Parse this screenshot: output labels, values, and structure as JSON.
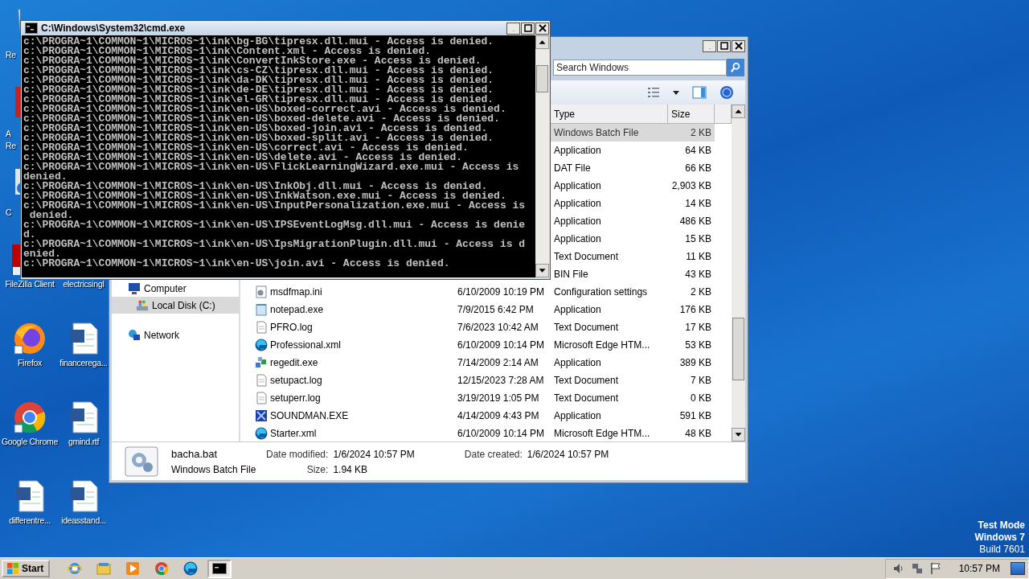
{
  "desktop": {
    "columns": [
      [
        {
          "label": "Re",
          "kind": "bin",
          "covered": true
        },
        {
          "label": "A Re",
          "kind": "acrobat",
          "covered": true
        },
        {
          "label": "C",
          "kind": "app",
          "covered": true
        },
        {
          "label": "FileZilla Client",
          "kind": "filezilla",
          "covered": false
        },
        {
          "label": "Firefox",
          "kind": "firefox",
          "covered": false
        },
        {
          "label": "Google Chrome",
          "kind": "chrome",
          "covered": false
        },
        {
          "label": "differentre...",
          "kind": "word",
          "covered": false
        }
      ],
      [
        {
          "label": "electricsingl",
          "kind": "word",
          "covered": false
        },
        {
          "label": "financerega...",
          "kind": "word",
          "covered": false
        },
        {
          "label": "gmind.rtf",
          "kind": "word",
          "covered": false
        },
        {
          "label": "ideasstand...",
          "kind": "word",
          "covered": false
        }
      ]
    ]
  },
  "explorer": {
    "search": {
      "placeholder": "Search Windows"
    },
    "columns": [
      "Type",
      "Size"
    ],
    "nav": [
      {
        "label": "Computer",
        "kind": "computer",
        "selected": false,
        "children": [
          {
            "label": "Local Disk (C:)",
            "kind": "drive",
            "selected": true
          }
        ]
      },
      {
        "label": "Network",
        "kind": "network",
        "selected": false
      }
    ],
    "rows": [
      {
        "type": "Windows Batch File",
        "size": "2 KB",
        "selected": true
      },
      {
        "type": "Application",
        "size": "64 KB",
        "selected": false
      },
      {
        "type": "DAT File",
        "size": "66 KB",
        "selected": false
      },
      {
        "type": "Application",
        "size": "2,903 KB",
        "selected": false
      },
      {
        "type": "Application",
        "size": "14 KB",
        "selected": false
      },
      {
        "type": "Application",
        "size": "486 KB",
        "selected": false
      },
      {
        "type": "Application",
        "size": "15 KB",
        "selected": false
      },
      {
        "type": "Text Document",
        "size": "11 KB",
        "selected": false
      },
      {
        "type": "BIN File",
        "size": "43 KB",
        "selected": false
      },
      {
        "name": "msdfmap.ini",
        "kind": "ini",
        "date": "6/10/2009 10:19 PM",
        "type": "Configuration settings",
        "size": "2 KB",
        "selected": false
      },
      {
        "name": "notepad.exe",
        "kind": "notepad",
        "date": "7/9/2015 6:42 PM",
        "type": "Application",
        "size": "176 KB",
        "selected": false
      },
      {
        "name": "PFRO.log",
        "kind": "text",
        "date": "7/6/2023 10:42 AM",
        "type": "Text Document",
        "size": "17 KB",
        "selected": false
      },
      {
        "name": "Professional.xml",
        "kind": "edge",
        "date": "6/10/2009 10:14 PM",
        "type": "Microsoft Edge HTM...",
        "size": "53 KB",
        "selected": false
      },
      {
        "name": "regedit.exe",
        "kind": "regedit",
        "date": "7/14/2009 2:14 AM",
        "type": "Application",
        "size": "389 KB",
        "selected": false
      },
      {
        "name": "setupact.log",
        "kind": "text",
        "date": "12/15/2023 7:28 AM",
        "type": "Text Document",
        "size": "7 KB",
        "selected": false
      },
      {
        "name": "setuperr.log",
        "kind": "text",
        "date": "3/19/2019 1:05 PM",
        "type": "Text Document",
        "size": "0 KB",
        "selected": false
      },
      {
        "name": "SOUNDMAN.EXE",
        "kind": "sound",
        "date": "4/14/2009 4:43 PM",
        "type": "Application",
        "size": "591 KB",
        "selected": false
      },
      {
        "name": "Starter.xml",
        "kind": "edge",
        "date": "6/10/2009 10:14 PM",
        "type": "Microsoft Edge HTM...",
        "size": "48 KB",
        "selected": false
      }
    ],
    "details": {
      "name": "bacha.bat",
      "type": "Windows Batch File",
      "modified_label": "Date modified:",
      "modified": "1/6/2024 10:57 PM",
      "created_label": "Date created:",
      "created": "1/6/2024 10:57 PM",
      "size_label": "Size:",
      "size": "1.94 KB"
    }
  },
  "cmd": {
    "title": "C:\\Windows\\System32\\cmd.exe",
    "lines": [
      "c:\\PROGRA~1\\COMMON~1\\MICROS~1\\ink\\bg-BG\\tipresx.dll.mui - Access is denied.",
      "c:\\PROGRA~1\\COMMON~1\\MICROS~1\\ink\\Content.xml - Access is denied.",
      "c:\\PROGRA~1\\COMMON~1\\MICROS~1\\ink\\ConvertInkStore.exe - Access is denied.",
      "c:\\PROGRA~1\\COMMON~1\\MICROS~1\\ink\\cs-CZ\\tipresx.dll.mui - Access is denied.",
      "c:\\PROGRA~1\\COMMON~1\\MICROS~1\\ink\\da-DK\\tipresx.dll.mui - Access is denied.",
      "c:\\PROGRA~1\\COMMON~1\\MICROS~1\\ink\\de-DE\\tipresx.dll.mui - Access is denied.",
      "c:\\PROGRA~1\\COMMON~1\\MICROS~1\\ink\\el-GR\\tipresx.dll.mui - Access is denied.",
      "c:\\PROGRA~1\\COMMON~1\\MICROS~1\\ink\\en-US\\boxed-correct.avi - Access is denied.",
      "c:\\PROGRA~1\\COMMON~1\\MICROS~1\\ink\\en-US\\boxed-delete.avi - Access is denied.",
      "c:\\PROGRA~1\\COMMON~1\\MICROS~1\\ink\\en-US\\boxed-join.avi - Access is denied.",
      "c:\\PROGRA~1\\COMMON~1\\MICROS~1\\ink\\en-US\\boxed-split.avi - Access is denied.",
      "c:\\PROGRA~1\\COMMON~1\\MICROS~1\\ink\\en-US\\correct.avi - Access is denied.",
      "c:\\PROGRA~1\\COMMON~1\\MICROS~1\\ink\\en-US\\delete.avi - Access is denied.",
      "c:\\PROGRA~1\\COMMON~1\\MICROS~1\\ink\\en-US\\FlickLearningWizard.exe.mui - Access is",
      "denied.",
      "c:\\PROGRA~1\\COMMON~1\\MICROS~1\\ink\\en-US\\InkObj.dll.mui - Access is denied.",
      "c:\\PROGRA~1\\COMMON~1\\MICROS~1\\ink\\en-US\\InkWatson.exe.mui - Access is denied.",
      "c:\\PROGRA~1\\COMMON~1\\MICROS~1\\ink\\en-US\\InputPersonalization.exe.mui - Access is",
      " denied.",
      "c:\\PROGRA~1\\COMMON~1\\MICROS~1\\ink\\en-US\\IPSEventLogMsg.dll.mui - Access is denie",
      "d.",
      "c:\\PROGRA~1\\COMMON~1\\MICROS~1\\ink\\en-US\\IpsMigrationPlugin.dll.mui - Access is d",
      "enied.",
      "c:\\PROGRA~1\\COMMON~1\\MICROS~1\\ink\\en-US\\join.avi - Access is denied."
    ]
  },
  "system_notice": [
    {
      "text": "Test Mode",
      "bold": true
    },
    {
      "text": "Windows 7",
      "bold": true
    },
    {
      "text": "Build 7601",
      "bold": false
    }
  ],
  "taskbar": {
    "start": "Start",
    "apps": [
      {
        "kind": "ie",
        "active": false
      },
      {
        "kind": "explorer",
        "active": false
      },
      {
        "kind": "media",
        "active": false
      },
      {
        "kind": "chrome",
        "active": false
      },
      {
        "kind": "edge",
        "active": false
      },
      {
        "kind": "cmd",
        "active": true
      }
    ],
    "clock": "10:57 PM"
  }
}
